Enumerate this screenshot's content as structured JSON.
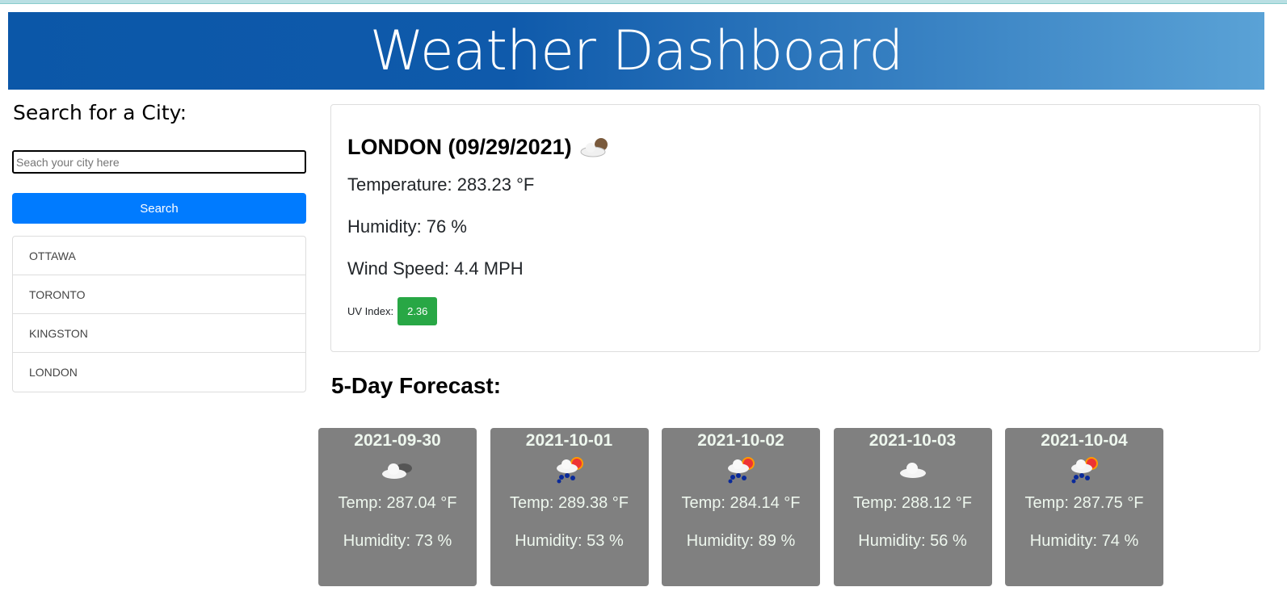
{
  "header": {
    "title": "Weather Dashboard"
  },
  "search": {
    "heading": "Search for a City:",
    "placeholder": "Seach your city here",
    "button_label": "Search",
    "history": [
      "OTTAWA",
      "TORONTO",
      "KINGSTON",
      "LONDON"
    ]
  },
  "current": {
    "title": "LONDON (09/29/2021)",
    "icon": "cloud-moon-icon",
    "temperature": "Temperature: 283.23 °F",
    "humidity": "Humidity: 76 %",
    "wind": "Wind Speed: 4.4 MPH",
    "uv_label": "UV Index:",
    "uv_value": "2.36",
    "uv_color": "#28a745"
  },
  "forecast": {
    "heading": "5-Day Forecast:",
    "days": [
      {
        "date": "2021-09-30",
        "icon": "cloudy-icon",
        "temp": "Temp: 287.04 °F",
        "humidity": "Humidity: 73 %"
      },
      {
        "date": "2021-10-01",
        "icon": "rain-sun-icon",
        "temp": "Temp: 289.38 °F",
        "humidity": "Humidity: 53 %"
      },
      {
        "date": "2021-10-02",
        "icon": "rain-sun-icon",
        "temp": "Temp: 284.14 °F",
        "humidity": "Humidity: 89 %"
      },
      {
        "date": "2021-10-03",
        "icon": "cloud-icon",
        "temp": "Temp: 288.12 °F",
        "humidity": "Humidity: 56 %"
      },
      {
        "date": "2021-10-04",
        "icon": "rain-sun-icon",
        "temp": "Temp: 287.75 °F",
        "humidity": "Humidity: 74 %"
      }
    ]
  }
}
